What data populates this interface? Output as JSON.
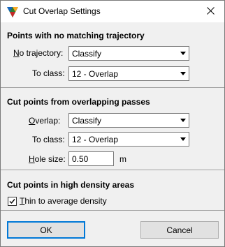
{
  "window": {
    "title": "Cut Overlap Settings",
    "icon": "app-logo-icon",
    "close_icon": "close-icon"
  },
  "section1": {
    "title": "Points with no matching trajectory",
    "no_trajectory_label_accel": "N",
    "no_trajectory_label_rest": "o trajectory:",
    "no_trajectory_value": "Classify",
    "to_class_label": "To class:",
    "to_class_value": "12 - Overlap"
  },
  "section2": {
    "title": "Cut points from overlapping passes",
    "overlap_label_accel": "O",
    "overlap_label_rest": "verlap:",
    "overlap_value": "Classify",
    "to_class_label": "To class:",
    "to_class_value": "12 - Overlap",
    "hole_size_label_accel": "H",
    "hole_size_label_rest": "ole size:",
    "hole_size_value": "0.50",
    "hole_size_unit": "m"
  },
  "section3": {
    "title": "Cut points in high density areas",
    "thin_label_accel": "T",
    "thin_label_rest": "hin to average density",
    "thin_checked": true
  },
  "buttons": {
    "ok": "OK",
    "cancel": "Cancel"
  }
}
